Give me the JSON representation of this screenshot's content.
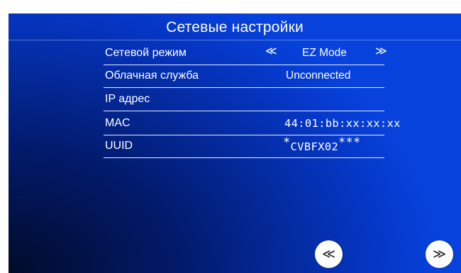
{
  "page": {
    "title": "Сетевые настройки"
  },
  "settings": [
    {
      "label": "Сетевой режим",
      "value": "EZ Mode"
    },
    {
      "label": "Облачная служба",
      "value": "Unconnected"
    },
    {
      "label": "IP адрес",
      "value": ""
    },
    {
      "label": "MAC",
      "value": "44:01:bb:xx:xx:xx"
    },
    {
      "label": "UUID",
      "value_prefix": "*",
      "value": "CVBFX02",
      "value_suffix": "***"
    }
  ],
  "mode_selector": {
    "prev_glyph": "≪",
    "next_glyph": "≫"
  },
  "nav": {
    "prev_glyph": "≪",
    "next_glyph": "≫"
  },
  "colors": {
    "background": "#0536c4",
    "text": "#ffffff",
    "button": "#ffffff"
  },
  "icons": [
    "double-left-arrow-icon",
    "double-right-arrow-icon"
  ]
}
